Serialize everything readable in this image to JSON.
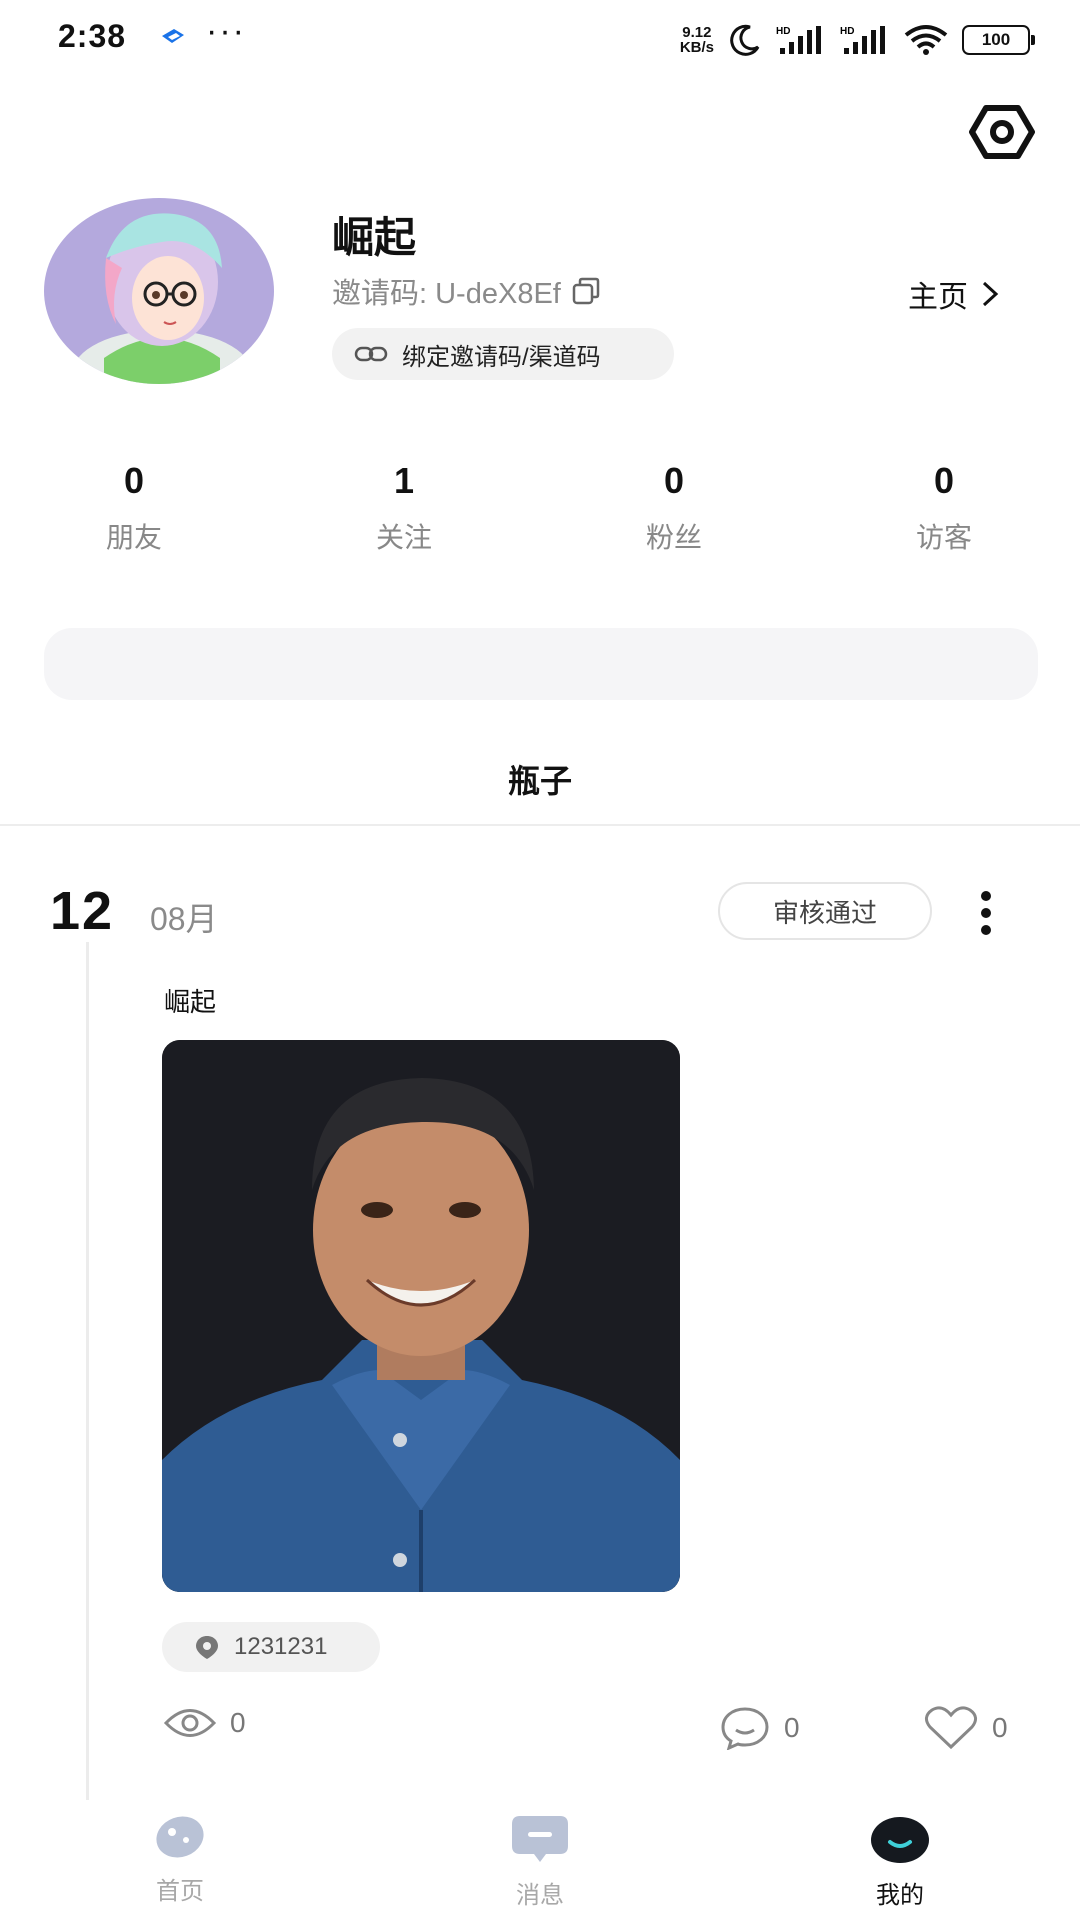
{
  "status_bar": {
    "time": "2:38",
    "more": "···",
    "net_speed_value": "9.12",
    "net_speed_unit": "KB/s",
    "battery": "100"
  },
  "profile": {
    "username": "崛起",
    "invite_code": "邀请码: U-deX8Ef",
    "bind_label": "绑定邀请码/渠道码",
    "homepage_label": "主页"
  },
  "stats": [
    {
      "value": "0",
      "label": "朋友"
    },
    {
      "value": "1",
      "label": "关注"
    },
    {
      "value": "0",
      "label": "粉丝"
    },
    {
      "value": "0",
      "label": "访客"
    }
  ],
  "section_tab": "瓶子",
  "post": {
    "day": "12",
    "month": "08月",
    "status": "审核通过",
    "text": "崛起",
    "location": "1231231",
    "views": "0",
    "comments": "0",
    "likes": "0"
  },
  "bottom_nav": [
    {
      "label": "首页"
    },
    {
      "label": "消息"
    },
    {
      "label": "我的"
    }
  ],
  "colors": {
    "accent": "#3fd0d8",
    "inactive_icon": "#b9c2d6",
    "muted_text": "#8a8a8a"
  }
}
